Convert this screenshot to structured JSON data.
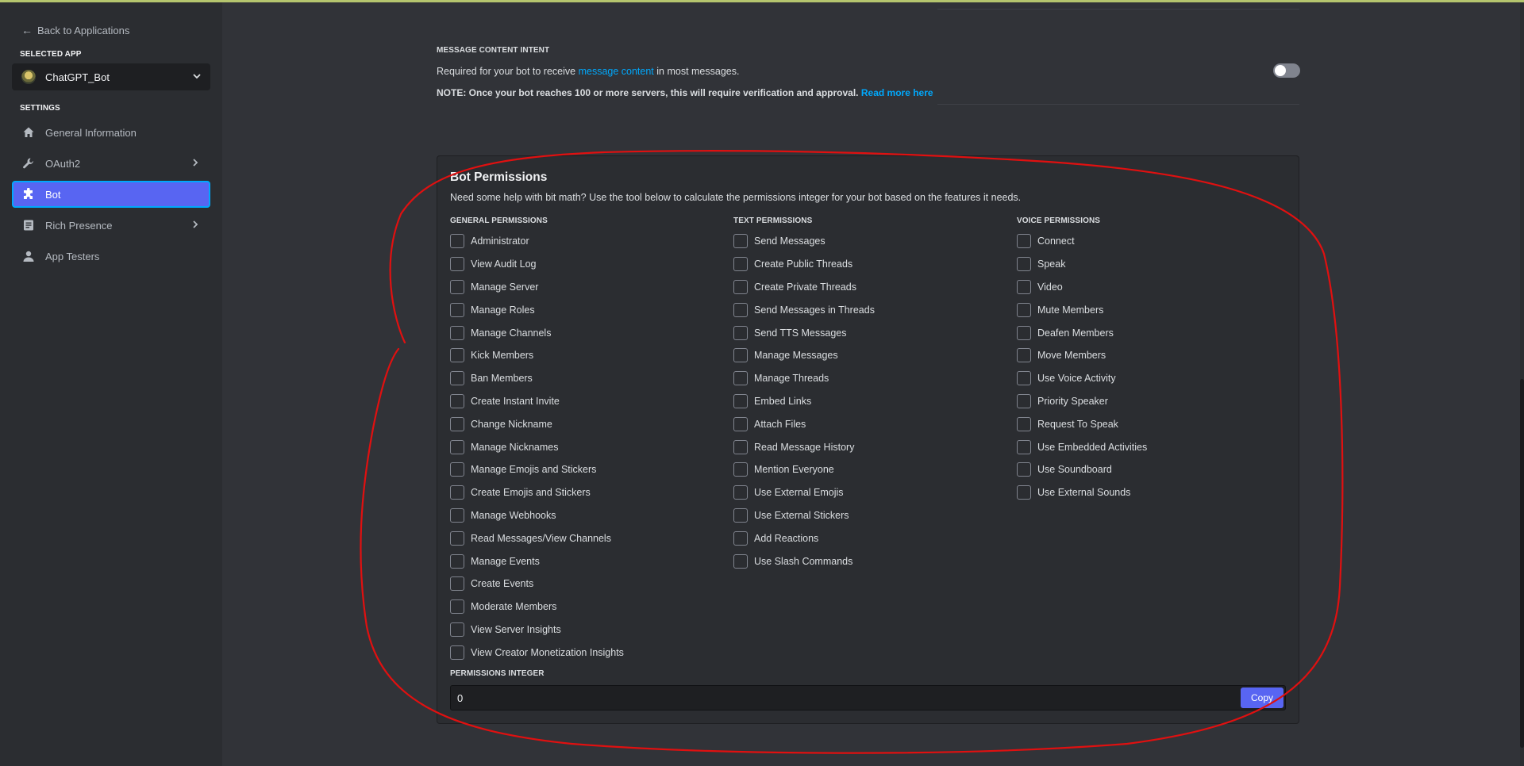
{
  "sidebar": {
    "back_label": "Back to Applications",
    "selected_app_title": "Selected App",
    "app_name": "ChatGPT_Bot",
    "settings_title": "Settings",
    "nav": [
      {
        "label": "General Information",
        "icon": "home-icon"
      },
      {
        "label": "OAuth2",
        "icon": "wrench-icon",
        "expandable": true
      },
      {
        "label": "Bot",
        "icon": "puzzle-icon",
        "active": true
      },
      {
        "label": "Rich Presence",
        "icon": "document-icon",
        "expandable": true
      },
      {
        "label": "App Testers",
        "icon": "person-icon"
      }
    ]
  },
  "intent": {
    "title": "Message Content Intent",
    "desc_before": "Required for your bot to receive ",
    "desc_link": "message content",
    "desc_after": " in most messages.",
    "note": "NOTE: Once your bot reaches 100 or more servers, this will require verification and approval.",
    "note_link": "Read more here",
    "toggle_on": false
  },
  "permissions": {
    "title": "Bot Permissions",
    "description": "Need some help with bit math? Use the tool below to calculate the permissions integer for your bot based on the features it needs.",
    "columns": [
      {
        "heading": "General Permissions",
        "items": [
          "Administrator",
          "View Audit Log",
          "Manage Server",
          "Manage Roles",
          "Manage Channels",
          "Kick Members",
          "Ban Members",
          "Create Instant Invite",
          "Change Nickname",
          "Manage Nicknames",
          "Manage Emojis and Stickers",
          "Create Emojis and Stickers",
          "Manage Webhooks",
          "Read Messages/View Channels",
          "Manage Events",
          "Create Events",
          "Moderate Members",
          "View Server Insights",
          "View Creator Monetization Insights"
        ]
      },
      {
        "heading": "Text Permissions",
        "items": [
          "Send Messages",
          "Create Public Threads",
          "Create Private Threads",
          "Send Messages in Threads",
          "Send TTS Messages",
          "Manage Messages",
          "Manage Threads",
          "Embed Links",
          "Attach Files",
          "Read Message History",
          "Mention Everyone",
          "Use External Emojis",
          "Use External Stickers",
          "Add Reactions",
          "Use Slash Commands"
        ]
      },
      {
        "heading": "Voice Permissions",
        "items": [
          "Connect",
          "Speak",
          "Video",
          "Mute Members",
          "Deafen Members",
          "Move Members",
          "Use Voice Activity",
          "Priority Speaker",
          "Request To Speak",
          "Use Embedded Activities",
          "Use Soundboard",
          "Use External Sounds"
        ]
      }
    ],
    "integer_label": "Permissions Integer",
    "integer_value": "0",
    "copy_label": "Copy"
  },
  "colors": {
    "accent": "#5865f2",
    "link": "#00a8fc",
    "annotation": "#e01010"
  }
}
